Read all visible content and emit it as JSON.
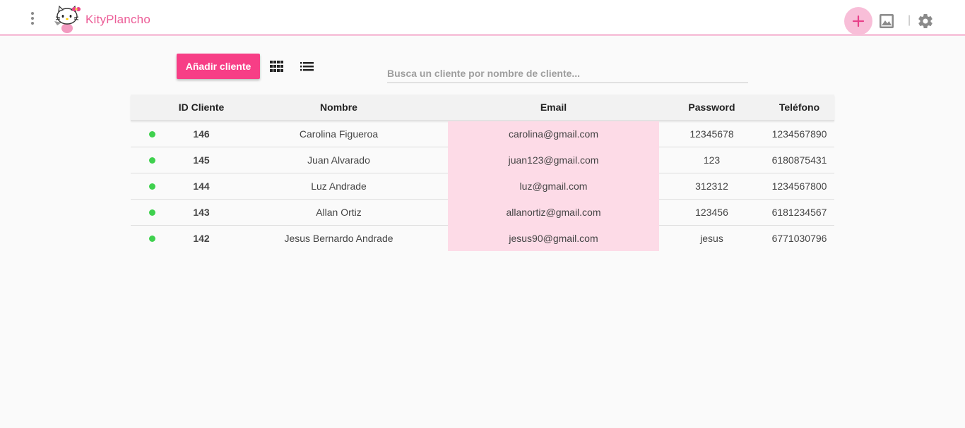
{
  "app": {
    "title": "KityPlancho"
  },
  "toolbar": {
    "add_client_label": "Añadir cliente"
  },
  "search": {
    "placeholder": "Busca un cliente por nombre de cliente...",
    "value": ""
  },
  "table": {
    "headers": {
      "id": "ID Cliente",
      "name": "Nombre",
      "email": "Email",
      "password": "Password",
      "phone": "Teléfono"
    },
    "rows": [
      {
        "status": "active",
        "id": "146",
        "name": "Carolina Figueroa",
        "email": "carolina@gmail.com",
        "password": "12345678",
        "phone": "1234567890"
      },
      {
        "status": "active",
        "id": "145",
        "name": "Juan Alvarado",
        "email": "juan123@gmail.com",
        "password": "123",
        "phone": "6180875431"
      },
      {
        "status": "active",
        "id": "144",
        "name": "Luz Andrade",
        "email": "luz@gmail.com",
        "password": "312312",
        "phone": "1234567800"
      },
      {
        "status": "active",
        "id": "143",
        "name": "Allan Ortiz",
        "email": "allanortiz@gmail.com",
        "password": "123456",
        "phone": "6181234567"
      },
      {
        "status": "active",
        "id": "142",
        "name": "Jesus Bernardo Andrade",
        "email": "jesus90@gmail.com",
        "password": "jesus",
        "phone": "6771030796"
      }
    ]
  },
  "icons": {
    "menu": "more-vert-icon",
    "logo": "hello-kitty-logo",
    "add": "plus-icon",
    "image": "image-icon",
    "settings": "gear-icon",
    "grid_view": "grid-view-icon",
    "list_view": "list-view-icon",
    "status": "status-dot-icon"
  },
  "colors": {
    "accent": "#f73e86",
    "title": "#ec5d97",
    "topbar_border": "#f7c6dc",
    "email_highlight": "#fddbe7",
    "status_active": "#3fd14e"
  }
}
